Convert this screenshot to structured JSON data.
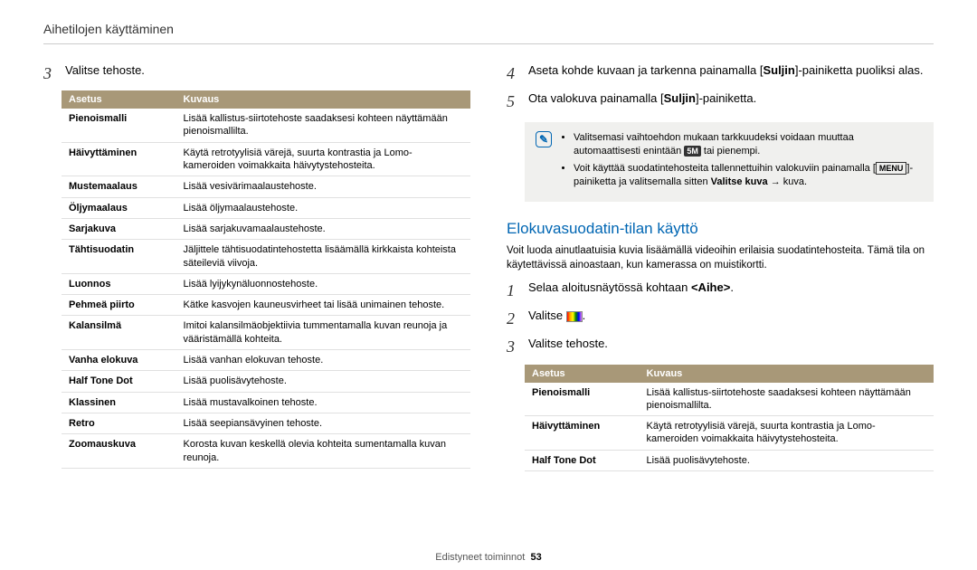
{
  "header": "Aihetilojen käyttäminen",
  "left": {
    "step3_num": "3",
    "step3_text": "Valitse tehoste.",
    "table": {
      "h1": "Asetus",
      "h2": "Kuvaus",
      "rows": [
        {
          "a": "Pienoismalli",
          "b": "Lisää kallistus-siirtotehoste saadaksesi kohteen näyttämään pienoismallilta."
        },
        {
          "a": "Häivyttäminen",
          "b": "Käytä retrotyylisiä värejä, suurta kontrastia ja Lomo-kameroiden voimakkaita häivytystehosteita."
        },
        {
          "a": "Mustemaalaus",
          "b": "Lisää vesivärimaalaustehoste."
        },
        {
          "a": "Öljymaalaus",
          "b": "Lisää öljymaalaustehoste."
        },
        {
          "a": "Sarjakuva",
          "b": "Lisää sarjakuvamaalaustehoste."
        },
        {
          "a": "Tähtisuodatin",
          "b": "Jäljittele tähtisuodatintehostetta lisäämällä kirkkaista kohteista säteileviä viivoja."
        },
        {
          "a": "Luonnos",
          "b": "Lisää lyijykynäluonnostehoste."
        },
        {
          "a": "Pehmeä piirto",
          "b": "Kätke kasvojen kauneusvirheet tai lisää unimainen tehoste."
        },
        {
          "a": "Kalansilmä",
          "b": "Imitoi kalansilmäobjektiivia tummentamalla kuvan reunoja ja vääristämällä kohteita."
        },
        {
          "a": "Vanha elokuva",
          "b": "Lisää vanhan elokuvan tehoste."
        },
        {
          "a": "Half Tone Dot",
          "b": "Lisää puolisävytehoste."
        },
        {
          "a": "Klassinen",
          "b": "Lisää mustavalkoinen tehoste."
        },
        {
          "a": "Retro",
          "b": "Lisää seepiansävyinen tehoste."
        },
        {
          "a": "Zoomauskuva",
          "b": "Korosta kuvan keskellä olevia kohteita sumentamalla kuvan reunoja."
        }
      ]
    }
  },
  "right": {
    "step4_num": "4",
    "step4_pre": "Aseta kohde kuvaan ja tarkenna painamalla [",
    "step4_bold": "Suljin",
    "step4_post": "]-painiketta puoliksi alas.",
    "step5_num": "5",
    "step5_pre": "Ota valokuva painamalla [",
    "step5_bold": "Suljin",
    "step5_post": "]-painiketta.",
    "note": {
      "li1_pre": "Valitsemasi vaihtoehdon mukaan tarkkuudeksi voidaan muuttaa automaattisesti enintään ",
      "li1_chip": "5M",
      "li1_post": " tai pienempi.",
      "li2_pre": "Voit käyttää suodatintehosteita tallennettuihin valokuviin painamalla [",
      "li2_menu": "MENU",
      "li2_mid": "]-painiketta ja valitsemalla sitten ",
      "li2_bold": "Valitse kuva",
      "li2_post": " → kuva."
    },
    "section_title": "Elokuvasuodatin-tilan käyttö",
    "section_intro": "Voit luoda ainutlaatuisia kuvia lisäämällä videoihin erilaisia suodatintehosteita. Tämä tila on käytettävissä ainoastaan, kun kamerassa on muistikortti.",
    "s1_num": "1",
    "s1_pre": "Selaa aloitusnäytössä kohtaan ",
    "s1_bold": "<Aihe>",
    "s1_post": ".",
    "s2_num": "2",
    "s2_text": "Valitse ",
    "s3_num": "3",
    "s3_text": "Valitse tehoste.",
    "table2": {
      "h1": "Asetus",
      "h2": "Kuvaus",
      "rows": [
        {
          "a": "Pienoismalli",
          "b": "Lisää kallistus-siirtotehoste saadaksesi kohteen näyttämään pienoismallilta."
        },
        {
          "a": "Häivyttäminen",
          "b": "Käytä retrotyylisiä värejä, suurta kontrastia ja Lomo-kameroiden voimakkaita häivytystehosteita."
        },
        {
          "a": "Half Tone Dot",
          "b": "Lisää puolisävytehoste."
        }
      ]
    }
  },
  "footer_label": "Edistyneet toiminnot",
  "footer_page": "53"
}
